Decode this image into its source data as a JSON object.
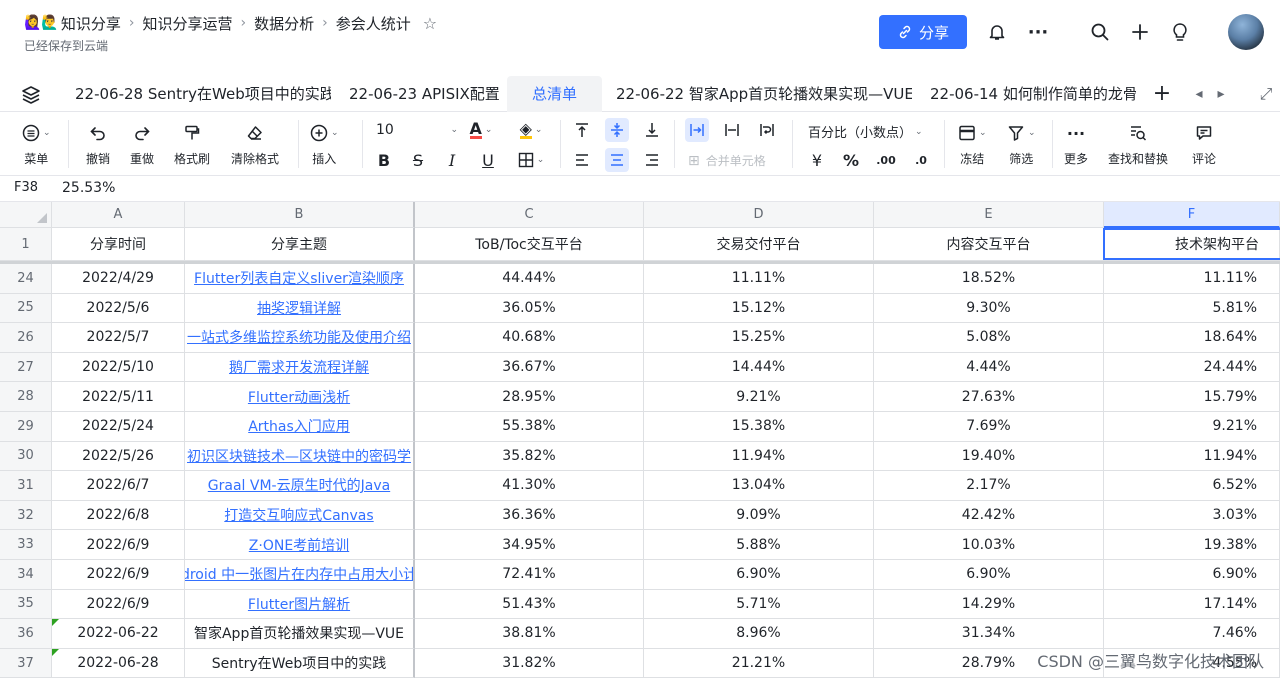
{
  "header": {
    "breadcrumbs": [
      "知识分享",
      "知识分享运营",
      "数据分析",
      "参会人统计"
    ],
    "emoji": "🙋‍♀️🙋‍♂️",
    "saved_status": "已经保存到云端",
    "share_label": "分享"
  },
  "tabs": {
    "items": [
      {
        "label": "22-06-28 Sentry在Web项目中的实践",
        "active": false
      },
      {
        "label": "22-06-23 APISIX配置",
        "active": false
      },
      {
        "label": "总清单",
        "active": true
      },
      {
        "label": "22-06-22 智家App首页轮播效果实现—VUE",
        "active": false
      },
      {
        "label": "22-06-14 如何制作简单的龙骨",
        "active": false
      }
    ],
    "add": "+",
    "prev": "◂",
    "next": "▸",
    "expand": "⤢"
  },
  "toolbar": {
    "menu": "菜单",
    "undo": "撤销",
    "redo": "重做",
    "format_painter": "格式刷",
    "clear_format": "清除格式",
    "insert": "插入",
    "font_size": "10",
    "merge": "合并单元格",
    "number_format": "百分比（小数点）",
    "currency": "¥",
    "percent": "%",
    "freeze": "冻结",
    "filter": "筛选",
    "more": "更多",
    "find_replace": "查找和替换",
    "comment": "评论",
    "accent": "#3370ff"
  },
  "formula_bar": {
    "cell_ref": "F38",
    "value": "25.53%"
  },
  "columns": [
    "A",
    "B",
    "C",
    "D",
    "E",
    "F"
  ],
  "header_row": {
    "num": "1",
    "cells": [
      "分享时间",
      "分享主题",
      "ToB/Toc交互平台",
      "交易交付平台",
      "内容交互平台",
      "技术架构平台"
    ]
  },
  "rows": [
    {
      "num": "24",
      "date": "2022/4/29",
      "topic": "Flutter列表自定义sliver渲染顺序",
      "link": true,
      "c": "44.44%",
      "d": "11.11%",
      "e": "18.52%",
      "f": "11.11%"
    },
    {
      "num": "25",
      "date": "2022/5/6",
      "topic": "抽奖逻辑详解",
      "link": true,
      "c": "36.05%",
      "d": "15.12%",
      "e": "9.30%",
      "f": "5.81%"
    },
    {
      "num": "26",
      "date": "2022/5/7",
      "topic": "一站式多维监控系统功能及使用介绍",
      "link": true,
      "c": "40.68%",
      "d": "15.25%",
      "e": "5.08%",
      "f": "18.64%"
    },
    {
      "num": "27",
      "date": "2022/5/10",
      "topic": "鹅厂需求开发流程详解",
      "link": true,
      "c": "36.67%",
      "d": "14.44%",
      "e": "4.44%",
      "f": "24.44%"
    },
    {
      "num": "28",
      "date": "2022/5/11",
      "topic": "Flutter动画浅析",
      "link": true,
      "c": "28.95%",
      "d": "9.21%",
      "e": "27.63%",
      "f": "15.79%"
    },
    {
      "num": "29",
      "date": "2022/5/24",
      "topic": "Arthas入门应用",
      "link": true,
      "c": "55.38%",
      "d": "15.38%",
      "e": "7.69%",
      "f": "9.21%"
    },
    {
      "num": "30",
      "date": "2022/5/26",
      "topic": "初识区块链技术—区块链中的密码学",
      "link": true,
      "c": "35.82%",
      "d": "11.94%",
      "e": "19.40%",
      "f": "11.94%"
    },
    {
      "num": "31",
      "date": "2022/6/7",
      "topic": "Graal VM-云原生时代的Java",
      "link": true,
      "c": "41.30%",
      "d": "13.04%",
      "e": "2.17%",
      "f": "6.52%"
    },
    {
      "num": "32",
      "date": "2022/6/8",
      "topic": "打造交互响应式Canvas",
      "link": true,
      "c": "36.36%",
      "d": "9.09%",
      "e": "42.42%",
      "f": "3.03%"
    },
    {
      "num": "33",
      "date": "2022/6/9",
      "topic": "Z·ONE考前培训",
      "link": true,
      "c": "34.95%",
      "d": "5.88%",
      "e": "10.03%",
      "f": "19.38%"
    },
    {
      "num": "34",
      "date": "2022/6/9",
      "topic": "droid 中一张图片在内存中占用大小计",
      "link": true,
      "c": "72.41%",
      "d": "6.90%",
      "e": "6.90%",
      "f": "6.90%"
    },
    {
      "num": "35",
      "date": "2022/6/9",
      "topic": "Flutter图片解析",
      "link": true,
      "c": "51.43%",
      "d": "5.71%",
      "e": "14.29%",
      "f": "17.14%"
    },
    {
      "num": "36",
      "date": "2022-06-22",
      "topic": "智家App首页轮播效果实现—VUE",
      "link": false,
      "c": "38.81%",
      "d": "8.96%",
      "e": "31.34%",
      "f": "7.46%"
    },
    {
      "num": "37",
      "date": "2022-06-28",
      "topic": "Sentry在Web项目中的实践",
      "link": false,
      "c": "31.82%",
      "d": "21.21%",
      "e": "28.79%",
      "f": "4.55%"
    }
  ],
  "watermark": "CSDN @三翼鸟数字化技术团队"
}
